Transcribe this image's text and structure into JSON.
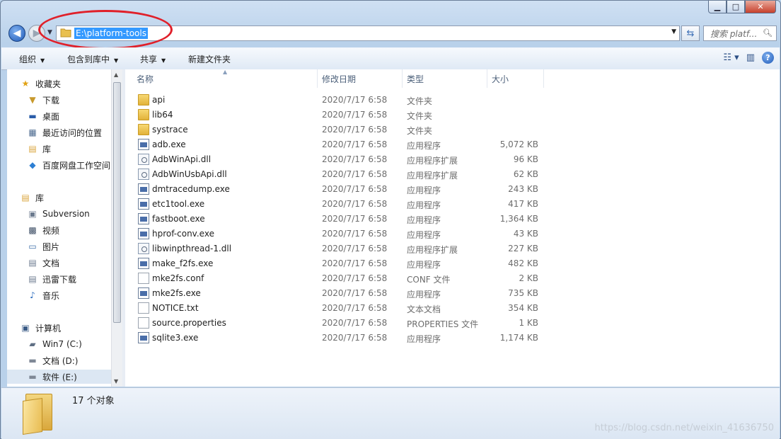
{
  "window": {
    "minimize": "▁",
    "maximize": "□",
    "close": "✕"
  },
  "address": {
    "path": "E:\\platform-tools",
    "search_placeholder": "搜索 platf..."
  },
  "toolbar": {
    "organize": "组织",
    "include_in_library": "包含到库中",
    "share": "共享",
    "new_folder": "新建文件夹"
  },
  "nav": {
    "favorites": "收藏夹",
    "downloads": "下载",
    "desktop": "桌面",
    "recent": "最近访问的位置",
    "library_fav": "库",
    "baidu": "百度网盘工作空间",
    "libraries": "库",
    "subversion": "Subversion",
    "videos": "视频",
    "pictures": "图片",
    "documents": "文档",
    "xunlei": "迅雷下载",
    "music": "音乐",
    "computer": "计算机",
    "drive_c": "Win7 (C:)",
    "drive_d": "文档 (D:)",
    "drive_e": "软件 (E:)"
  },
  "columns": {
    "name": "名称",
    "date": "修改日期",
    "type": "类型",
    "size": "大小"
  },
  "files": [
    {
      "name": "api",
      "date": "2020/7/17 6:58",
      "type": "文件夹",
      "size": "",
      "icon": "folder-icon"
    },
    {
      "name": "lib64",
      "date": "2020/7/17 6:58",
      "type": "文件夹",
      "size": "",
      "icon": "folder-icon"
    },
    {
      "name": "systrace",
      "date": "2020/7/17 6:58",
      "type": "文件夹",
      "size": "",
      "icon": "folder-icon"
    },
    {
      "name": "adb.exe",
      "date": "2020/7/17 6:58",
      "type": "应用程序",
      "size": "5,072 KB",
      "icon": "exe-icon"
    },
    {
      "name": "AdbWinApi.dll",
      "date": "2020/7/17 6:58",
      "type": "应用程序扩展",
      "size": "96 KB",
      "icon": "dll-icon"
    },
    {
      "name": "AdbWinUsbApi.dll",
      "date": "2020/7/17 6:58",
      "type": "应用程序扩展",
      "size": "62 KB",
      "icon": "dll-icon"
    },
    {
      "name": "dmtracedump.exe",
      "date": "2020/7/17 6:58",
      "type": "应用程序",
      "size": "243 KB",
      "icon": "exe-icon"
    },
    {
      "name": "etc1tool.exe",
      "date": "2020/7/17 6:58",
      "type": "应用程序",
      "size": "417 KB",
      "icon": "exe-icon"
    },
    {
      "name": "fastboot.exe",
      "date": "2020/7/17 6:58",
      "type": "应用程序",
      "size": "1,364 KB",
      "icon": "exe-icon"
    },
    {
      "name": "hprof-conv.exe",
      "date": "2020/7/17 6:58",
      "type": "应用程序",
      "size": "43 KB",
      "icon": "exe-icon"
    },
    {
      "name": "libwinpthread-1.dll",
      "date": "2020/7/17 6:58",
      "type": "应用程序扩展",
      "size": "227 KB",
      "icon": "dll-icon"
    },
    {
      "name": "make_f2fs.exe",
      "date": "2020/7/17 6:58",
      "type": "应用程序",
      "size": "482 KB",
      "icon": "exe-icon"
    },
    {
      "name": "mke2fs.conf",
      "date": "2020/7/17 6:58",
      "type": "CONF 文件",
      "size": "2 KB",
      "icon": "document-icon"
    },
    {
      "name": "mke2fs.exe",
      "date": "2020/7/17 6:58",
      "type": "应用程序",
      "size": "735 KB",
      "icon": "exe-icon"
    },
    {
      "name": "NOTICE.txt",
      "date": "2020/7/17 6:58",
      "type": "文本文档",
      "size": "354 KB",
      "icon": "document-icon"
    },
    {
      "name": "source.properties",
      "date": "2020/7/17 6:58",
      "type": "PROPERTIES 文件",
      "size": "1 KB",
      "icon": "document-icon"
    },
    {
      "name": "sqlite3.exe",
      "date": "2020/7/17 6:58",
      "type": "应用程序",
      "size": "1,174 KB",
      "icon": "exe-icon"
    }
  ],
  "status": {
    "count": "17 个对象"
  },
  "watermark": "https://blog.csdn.net/weixin_41636750",
  "colors": {
    "selection": "#3399ff",
    "annotation_circle": "#e0202a"
  }
}
